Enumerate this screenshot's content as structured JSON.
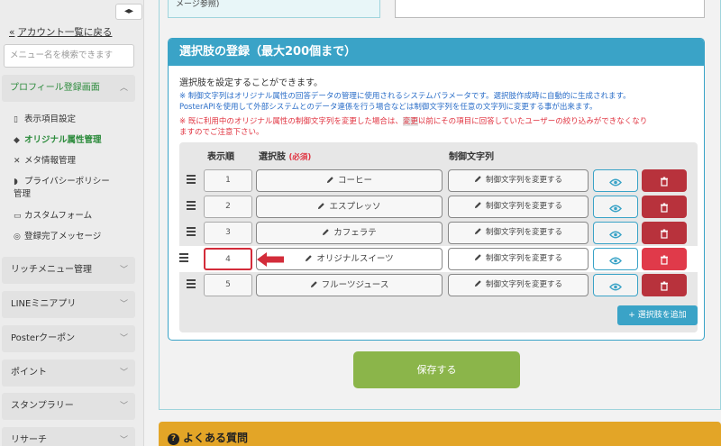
{
  "sidebar": {
    "collapse": "◂▸",
    "back_label": "アカウント一覧に戻る",
    "search_placeholder": "メニュー名を検索できます",
    "open_section": "プロフィール登録画面",
    "sub_items": [
      {
        "label": "表示項目設定",
        "icon": "phone-icon"
      },
      {
        "label": "オリジナル属性管理",
        "icon": "tag-icon"
      },
      {
        "label": "メタ情報管理",
        "icon": "tools-icon"
      },
      {
        "label": "プライバシーポリシー",
        "icon": "shield-icon"
      },
      {
        "label": "管理",
        "icon": ""
      },
      {
        "label": "カスタムフォーム",
        "icon": "card-icon"
      },
      {
        "label": "登録完了メッセージ",
        "icon": "check-circle-icon"
      }
    ],
    "sections": [
      "リッチメニュー管理",
      "LINEミニアプリ",
      "Posterクーポン",
      "ポイント",
      "スタンプラリー",
      "リサーチ"
    ]
  },
  "top_fragment": "メージ参照)",
  "card": {
    "title": "選択肢の登録（最大200個まで）",
    "intro": "選択肢を設定することができます。",
    "note1": "※ 制御文字列はオリジナル属性の回答データの管理に使用されるシステムパラメータです。選択肢作成時に自動的に生成されます。",
    "note2": "PosterAPIを使用して外部システムとのデータ連係を行う場合などは制御文字列を任意の文字列に変更する事が出来ます。",
    "warn1_a": "※ 既に利用中のオリジナル属性の制御文字列を変更した場合は、",
    "warn1_hl": "変更",
    "warn1_b": "以前にその項目に回答していたユーザーの絞り込みができなくなり",
    "warn2": "ますのでご注意下さい。"
  },
  "table": {
    "col_order": "表示順",
    "col_option": "選択肢",
    "col_required": "(必須)",
    "col_control": "制御文字列",
    "control_button_label": "制御文字列を変更する",
    "rows": [
      {
        "order": "1",
        "option": "コーヒー"
      },
      {
        "order": "2",
        "option": "エスプレッソ"
      },
      {
        "order": "3",
        "option": "カフェラテ"
      },
      {
        "order": "4",
        "option": "オリジナルスイーツ"
      },
      {
        "order": "5",
        "option": "フルーツジュース"
      }
    ],
    "highlighted_row": 4,
    "add_label": "選択肢を追加"
  },
  "save_label": "保存する",
  "faq_label": "よくある質問",
  "colors": {
    "accent": "#3aa3c7",
    "save": "#8bb54a",
    "delete": "#b8323c",
    "faq": "#e3a527",
    "active": "#2a8a3a"
  }
}
